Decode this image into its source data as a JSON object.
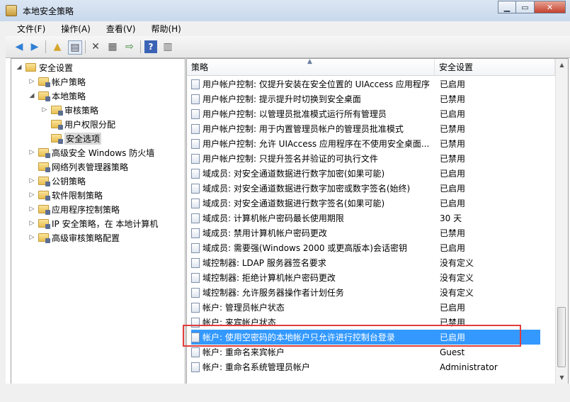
{
  "window": {
    "title": "本地安全策略"
  },
  "menu": [
    "文件(F)",
    "操作(A)",
    "查看(V)",
    "帮助(H)"
  ],
  "window_buttons": [
    "minimize",
    "maximize",
    "close"
  ],
  "toolbar": [
    "back-icon",
    "forward-icon",
    "up-icon",
    "show-hide-tree-icon",
    "delete-icon",
    "properties-icon",
    "export-icon",
    "help-icon",
    "view-icon"
  ],
  "tree": [
    {
      "label": "安全设置",
      "depth": 0,
      "expander": "expanded"
    },
    {
      "label": "帐户策略",
      "depth": 1,
      "expander": "collapsed"
    },
    {
      "label": "本地策略",
      "depth": 1,
      "expander": "expanded"
    },
    {
      "label": "审核策略",
      "depth": 2,
      "expander": "collapsed"
    },
    {
      "label": "用户权限分配",
      "depth": 2,
      "expander": "none"
    },
    {
      "label": "安全选项",
      "depth": 2,
      "expander": "none",
      "selected": true
    },
    {
      "label": "高级安全 Windows 防火墙",
      "depth": 1,
      "expander": "collapsed"
    },
    {
      "label": "网络列表管理器策略",
      "depth": 1,
      "expander": "none"
    },
    {
      "label": "公钥策略",
      "depth": 1,
      "expander": "collapsed"
    },
    {
      "label": "软件限制策略",
      "depth": 1,
      "expander": "collapsed"
    },
    {
      "label": "应用程序控制策略",
      "depth": 1,
      "expander": "collapsed"
    },
    {
      "label": "IP 安全策略，在 本地计算机",
      "depth": 1,
      "expander": "collapsed"
    },
    {
      "label": "高级审核策略配置",
      "depth": 1,
      "expander": "collapsed"
    }
  ],
  "columns": {
    "policy": "策略",
    "setting": "安全设置"
  },
  "rows": [
    {
      "policy": "用户帐户控制: 仅提升安装在安全位置的 UIAccess 应用程序",
      "setting": "已启用"
    },
    {
      "policy": "用户帐户控制: 提示提升时切换到安全桌面",
      "setting": "已禁用"
    },
    {
      "policy": "用户帐户控制: 以管理员批准模式运行所有管理员",
      "setting": "已启用"
    },
    {
      "policy": "用户帐户控制: 用于内置管理员帐户的管理员批准模式",
      "setting": "已禁用"
    },
    {
      "policy": "用户帐户控制: 允许 UIAccess 应用程序在不使用安全桌面...",
      "setting": "已禁用"
    },
    {
      "policy": "用户帐户控制: 只提升签名并验证的可执行文件",
      "setting": "已禁用"
    },
    {
      "policy": "域成员: 对安全通道数据进行数字加密(如果可能)",
      "setting": "已启用"
    },
    {
      "policy": "域成员: 对安全通道数据进行数字加密或数字签名(始终)",
      "setting": "已启用"
    },
    {
      "policy": "域成员: 对安全通道数据进行数字签名(如果可能)",
      "setting": "已启用"
    },
    {
      "policy": "域成员: 计算机帐户密码最长使用期限",
      "setting": "30 天"
    },
    {
      "policy": "域成员: 禁用计算机帐户密码更改",
      "setting": "已禁用"
    },
    {
      "policy": "域成员: 需要强(Windows 2000 或更高版本)会话密钥",
      "setting": "已启用"
    },
    {
      "policy": "域控制器: LDAP 服务器签名要求",
      "setting": "没有定义"
    },
    {
      "policy": "域控制器: 拒绝计算机帐户密码更改",
      "setting": "没有定义"
    },
    {
      "policy": "域控制器: 允许服务器操作者计划任务",
      "setting": "没有定义"
    },
    {
      "policy": "帐户: 管理员帐户状态",
      "setting": "已启用"
    },
    {
      "policy": "帐户: 来宾帐户状态",
      "setting": "已禁用"
    },
    {
      "policy": "帐户: 使用空密码的本地帐户只允许进行控制台登录",
      "setting": "已启用",
      "selected": true
    },
    {
      "policy": "帐户: 重命名来宾帐户",
      "setting": "Guest"
    },
    {
      "policy": "帐户: 重命名系统管理员帐户",
      "setting": "Administrator"
    }
  ],
  "colors": {
    "selection": "#3399ff",
    "highlight_box": "#e23c3c",
    "tree_selected": "#d9d9d9"
  }
}
